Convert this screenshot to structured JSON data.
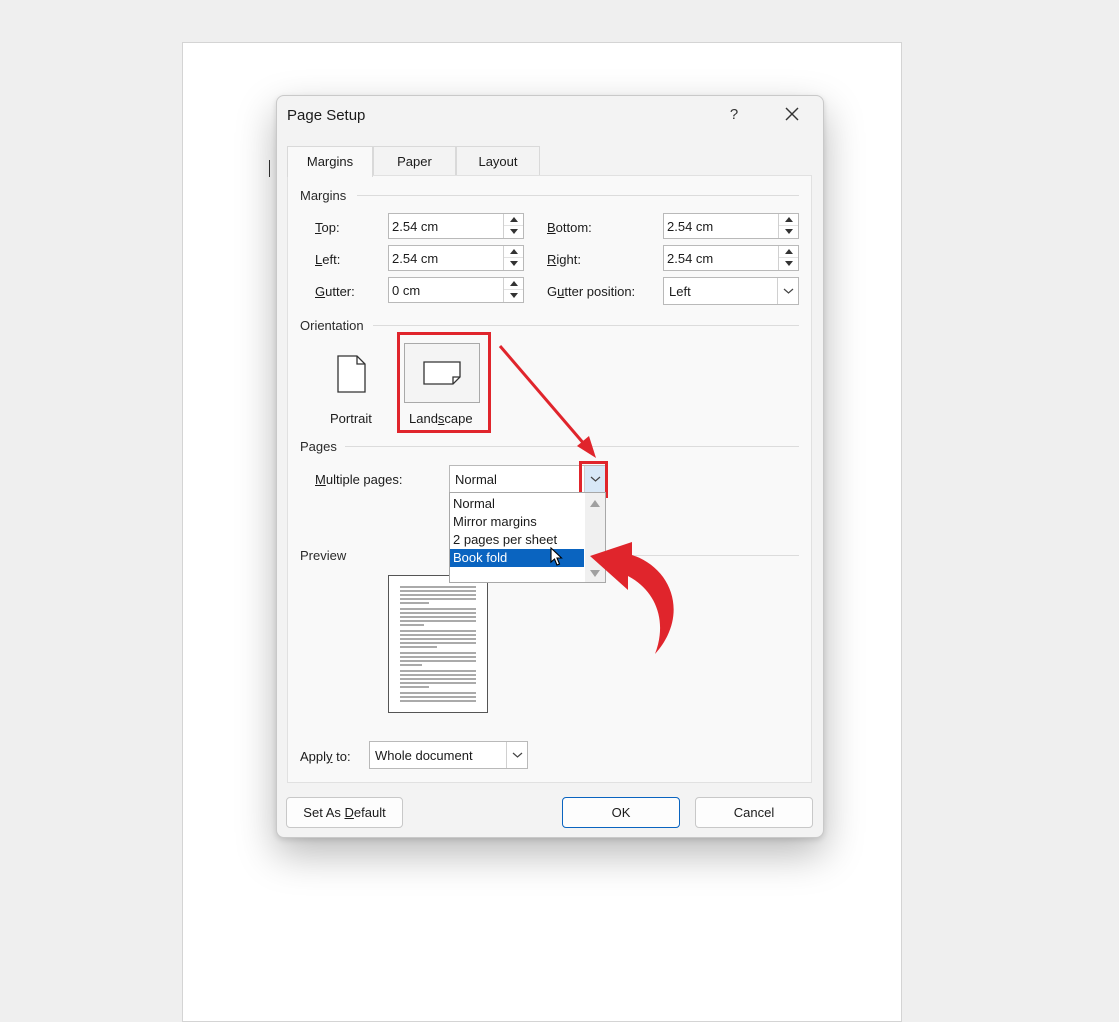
{
  "dialog": {
    "title": "Page Setup",
    "help_label": "?",
    "tabs": [
      {
        "label": "Margins",
        "active": true
      },
      {
        "label": "Paper",
        "active": false
      },
      {
        "label": "Layout",
        "active": false
      }
    ]
  },
  "margins": {
    "section_label": "Margins",
    "top": {
      "label_key": "T",
      "label_rest": "op:",
      "value": "2.54 cm"
    },
    "left": {
      "label_key": "L",
      "label_rest": "eft:",
      "value": "2.54 cm"
    },
    "gutter": {
      "label_key": "G",
      "label_rest": "utter:",
      "value": "0 cm"
    },
    "bottom": {
      "label_key": "B",
      "label_rest": "ottom:",
      "value": "2.54 cm"
    },
    "right": {
      "label_key": "R",
      "label_rest": "ight:",
      "value": "2.54 cm"
    },
    "gutter_position": {
      "label_pre": "G",
      "label_key": "u",
      "label_rest": "tter position:",
      "value": "Left"
    }
  },
  "orientation": {
    "section_label": "Orientation",
    "portrait_label": "Portrait",
    "landscape_pre": "Land",
    "landscape_key": "s",
    "landscape_rest": "cape",
    "selected": "Landscape"
  },
  "pages": {
    "section_label": "Pages",
    "multiple_pages_key": "M",
    "multiple_pages_rest": "ultiple pages:",
    "value": "Normal",
    "options": [
      "Normal",
      "Mirror margins",
      "2 pages per sheet",
      "Book fold"
    ],
    "highlighted_option": "Book fold"
  },
  "preview": {
    "section_label": "Preview",
    "apply_to_pre": "Appl",
    "apply_to_key": "y",
    "apply_to_rest": " to:",
    "apply_to_value": "Whole document"
  },
  "buttons": {
    "set_default_pre": "Set As ",
    "set_default_key": "D",
    "set_default_rest": "efault",
    "ok": "OK",
    "cancel": "Cancel"
  },
  "colors": {
    "annotation_red": "#e0252c",
    "selection_blue": "#0a64c0"
  }
}
